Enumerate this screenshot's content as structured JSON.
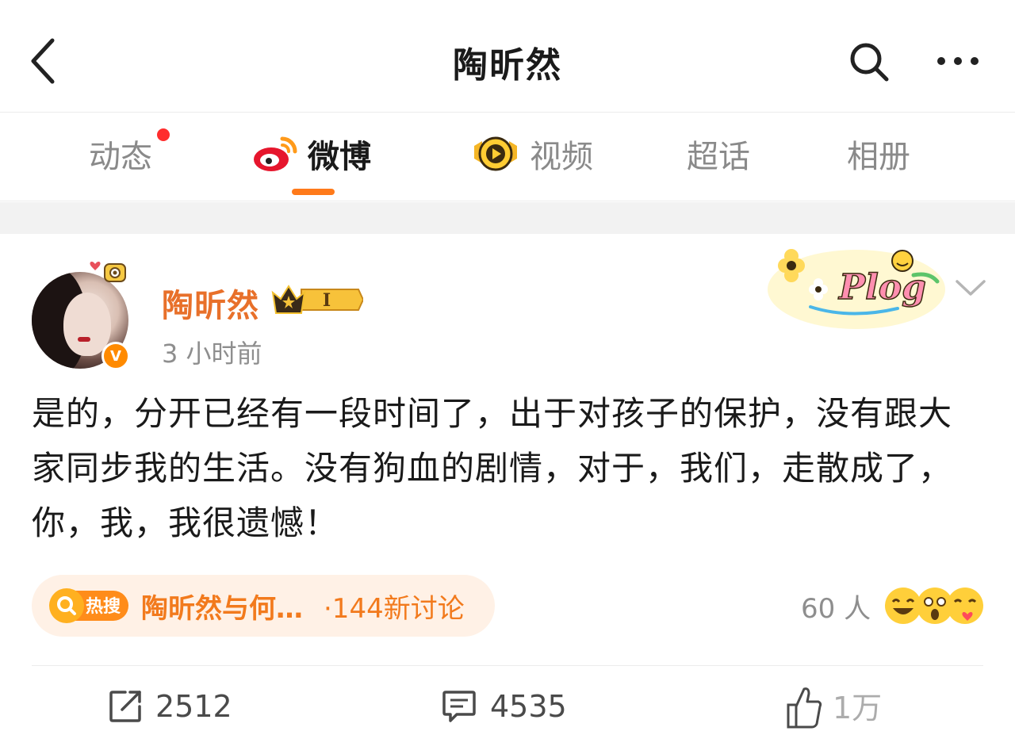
{
  "header": {
    "title": "陶昕然",
    "back_icon": "chevron-left-icon",
    "search_icon": "search-icon",
    "more_icon": "more-horizontal-icon"
  },
  "tabs": [
    {
      "label": "动态",
      "active": false,
      "has_dot": true
    },
    {
      "label": "微博",
      "active": true,
      "icon": "weibo-logo-icon"
    },
    {
      "label": "视频",
      "active": false,
      "icon": "video-badge-icon"
    },
    {
      "label": "超话",
      "active": false
    },
    {
      "label": "相册",
      "active": false
    }
  ],
  "post": {
    "author": "陶昕然",
    "level_badge": "I",
    "time": "3 小时前",
    "sticker_text": "Plog",
    "text": "是的，分开已经有一段时间了，出于对孩子的保护，没有跟大家同步我的生活。没有狗血的剧情，对于，我们，走散成了，你，我，我很遗憾！",
    "hot_search": {
      "tag": "热搜",
      "topic": "陶昕然与何…",
      "count": "·144新讨论"
    },
    "reactions": {
      "count": "60 人"
    },
    "actions": {
      "repost": "2512",
      "comment": "4535",
      "like": "1万"
    }
  },
  "colors": {
    "accent": "#ff7a1a",
    "author": "#e8702a",
    "hot_bg": "#fff1e6",
    "dot": "#ff2d2d"
  }
}
